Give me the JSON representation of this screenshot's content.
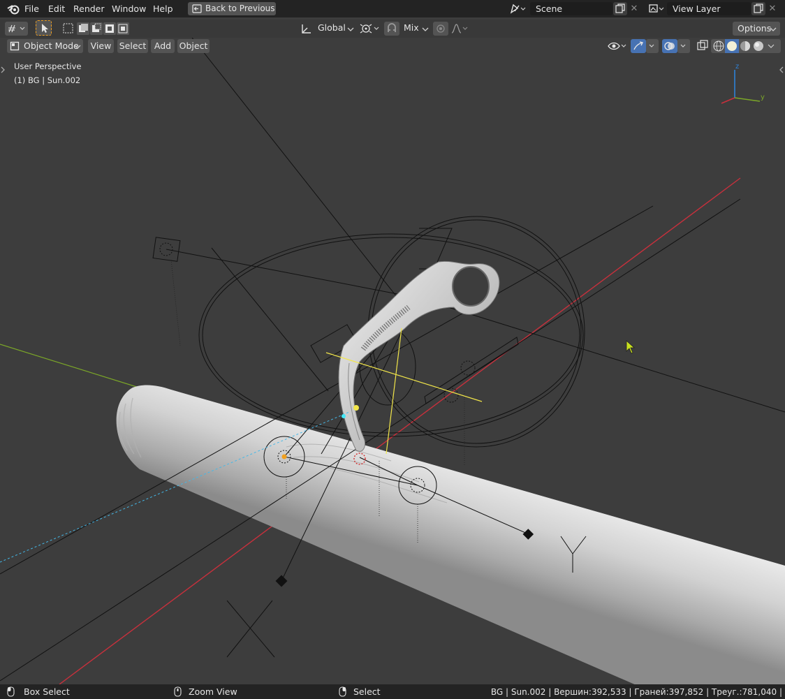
{
  "menu": {
    "file": "File",
    "edit": "Edit",
    "render": "Render",
    "window": "Window",
    "help": "Help",
    "back_to_previous": "Back to Previous"
  },
  "scene": {
    "name": "Scene"
  },
  "view_layer": {
    "name": "View Layer"
  },
  "toolbar": {
    "transform_orientation": "Global",
    "snap_mode": "Mix",
    "options": "Options"
  },
  "viewport_header": {
    "mode": "Object Mode",
    "view": "View",
    "select": "Select",
    "add": "Add",
    "object": "Object"
  },
  "viewport": {
    "perspective_label": "User Perspective",
    "active_object_label": "(1) BG | Sun.002",
    "gizmo_axes": {
      "z": "z",
      "y": "y"
    }
  },
  "statusbar": {
    "box_select": "Box Select",
    "zoom_view": "Zoom View",
    "select": "Select",
    "stats": "BG | Sun.002 | Вершин:392,533 | Граней:397,852 | Треуг.:781,040 |"
  },
  "colors": {
    "topbar_bg": "#232323",
    "toolbar_bg": "#393939",
    "viewport_bg": "#3d3d3d",
    "field_bg": "#1d1d1d",
    "button_bg": "#545454",
    "active_blue": "#4772b3",
    "x_axis": "#c8303c",
    "y_axis": "#7ba628",
    "z_axis": "#2e82d8",
    "light_yellow": "#f2e64a",
    "origin_orange": "#f0a020"
  },
  "icons": [
    "blender-logo-icon",
    "back-icon",
    "scene-icon",
    "copy-icon",
    "close-icon",
    "view-layer-icon",
    "transform-pivot-icon",
    "select-tool-icon",
    "select-mode-new-icon",
    "select-mode-extend-icon",
    "select-mode-subtract-icon",
    "select-mode-invert-icon",
    "select-mode-intersect-icon",
    "orientation-icon",
    "pivot-icon",
    "snap-icon",
    "proportional-edit-icon",
    "falloff-icon",
    "object-mode-icon",
    "visibility-icon",
    "gizmo-icon",
    "overlay-icon",
    "xray-icon",
    "wireframe-shading-icon",
    "solid-shading-icon",
    "material-shading-icon",
    "rendered-shading-icon",
    "mouse-left-icon",
    "mouse-middle-icon",
    "mouse-right-icon",
    "cursor-icon"
  ]
}
